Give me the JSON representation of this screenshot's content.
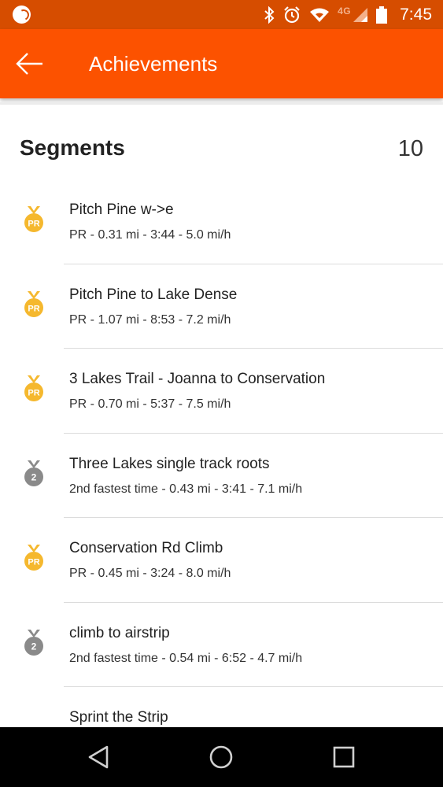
{
  "status_bar": {
    "time": "7:45",
    "network": "4G",
    "icons": [
      "strava-ball-icon",
      "bluetooth-icon",
      "alarm-icon",
      "wifi-icon",
      "cell-signal-icon",
      "battery-icon"
    ]
  },
  "app_bar": {
    "title": "Achievements",
    "back_icon": "arrow-left-icon",
    "color": "#fc5200"
  },
  "section": {
    "title": "Segments",
    "count": "10"
  },
  "colors": {
    "pr_gold": "#f5b82e",
    "second_gray": "#8a8a8a"
  },
  "segments": [
    {
      "name": "Pitch Pine w->e",
      "detail": "PR - 0.31 mi - 3:44 - 5.0 mi/h",
      "badge": "PR"
    },
    {
      "name": "Pitch Pine to Lake Dense",
      "detail": "PR - 1.07 mi - 8:53 - 7.2 mi/h",
      "badge": "PR"
    },
    {
      "name": "3 Lakes Trail - Joanna to Conservation",
      "detail": "PR - 0.70 mi - 5:37 - 7.5 mi/h",
      "badge": "PR"
    },
    {
      "name": "Three Lakes single track roots",
      "detail": "2nd fastest time - 0.43 mi - 3:41 - 7.1 mi/h",
      "badge": "2"
    },
    {
      "name": "Conservation Rd Climb",
      "detail": "PR - 0.45 mi - 3:24 - 8.0 mi/h",
      "badge": "PR"
    },
    {
      "name": "climb to airstrip",
      "detail": "2nd fastest time - 0.54 mi - 6:52 - 4.7 mi/h",
      "badge": "2"
    },
    {
      "name": "Sprint the Strip",
      "detail": "",
      "badge": ""
    }
  ],
  "nav_bar": {
    "buttons": [
      "back-triangle-icon",
      "home-circle-icon",
      "recents-square-icon"
    ]
  }
}
